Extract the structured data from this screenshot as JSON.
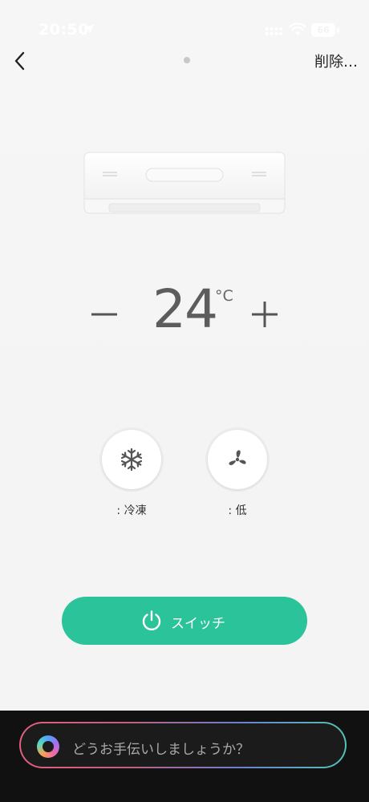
{
  "status_bar": {
    "time": "20:50",
    "battery": "66"
  },
  "header": {
    "action_label": "削除…"
  },
  "thermostat": {
    "temperature": "24",
    "unit": "°C"
  },
  "modes": {
    "mode_label": ": 冷凍",
    "fan_label": ": 低"
  },
  "power": {
    "label": "スイッチ"
  },
  "assistant": {
    "placeholder": "どうお手伝いしましょうか？"
  },
  "colors": {
    "accent": "#2bc39a",
    "background": "#f4f4f4",
    "bottom_bar": "#111111"
  }
}
